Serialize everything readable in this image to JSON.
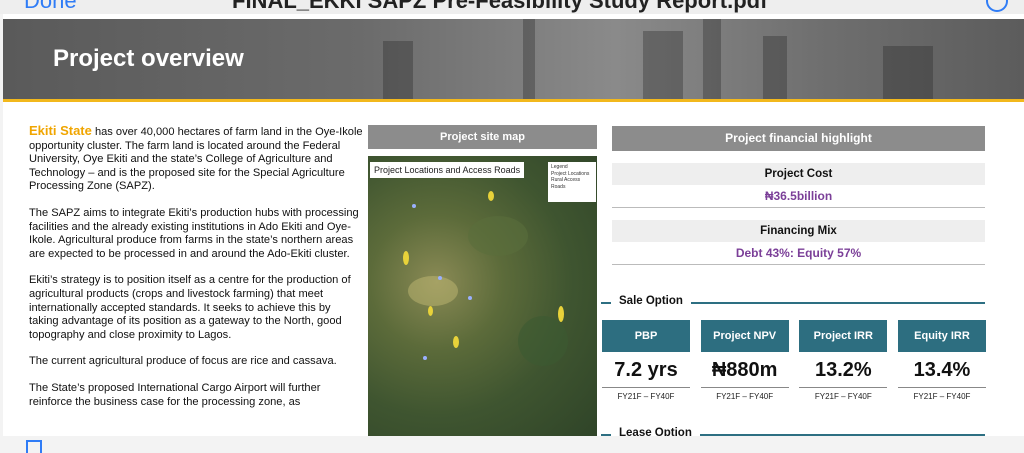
{
  "toolbar": {
    "done_label": "Done",
    "filename": "FINAL_EKKI SAPZ Pre-Feasibility Study Report.pdf",
    "compass_icon": "compass-icon",
    "share_icon": "share-icon"
  },
  "banner": {
    "title": "Project overview"
  },
  "left_text": {
    "state_name": "Ekiti State",
    "p1_rest": " has over 40,000 hectares of farm land in the Oye-Ikole opportunity cluster. The farm land is located around the Federal University, Oye Ekiti and the state’s College of Agriculture and Technology – and is the proposed site for the Special Agriculture Processing Zone (SAPZ).",
    "p2": "The SAPZ aims to integrate Ekiti’s production hubs with processing facilities and the already existing institutions in Ado Ekiti and Oye-Ikole. Agricultural produce from farms in the state’s northern areas are expected to be processed in and around the Ado-Ekiti cluster.",
    "p3": "Ekiti’s strategy is to position itself as a centre for the production of agricultural products (crops and livestock farming) that meet internationally accepted standards. It seeks to achieve this by taking advantage of its position as a gateway to the North, good topography and close proximity to Lagos.",
    "p4": "The current agricultural produce of focus are rice and cassava.",
    "p5": "The State’s proposed International Cargo Airport will further reinforce the business case for the processing zone, as"
  },
  "map": {
    "header": "Project site map",
    "label": "Project Locations and Access Roads",
    "legend_title": "Legend",
    "legend_item1": "Project Locations",
    "legend_item2": "Rural Access Roads"
  },
  "financial": {
    "header": "Project financial highlight",
    "cost_label": "Project Cost",
    "cost_value": "₦36.5billion",
    "mix_label": "Financing Mix",
    "mix_value": "Debt 43%: Equity 57%"
  },
  "sale_option": {
    "label": "Sale Option",
    "tiles": [
      {
        "head": "PBP",
        "value": "7.2 yrs",
        "period": "FY21F – FY40F"
      },
      {
        "head": "Project NPV",
        "value": "₦880m",
        "period": "FY21F – FY40F"
      },
      {
        "head": "Project IRR",
        "value": "13.2%",
        "period": "FY21F – FY40F"
      },
      {
        "head": "Equity IRR",
        "value": "13.4%",
        "period": "FY21F – FY40F"
      }
    ]
  },
  "lease_option": {
    "label": "Lease Option"
  },
  "colors": {
    "accent_gold": "#f2b81c",
    "teal": "#2d6e80",
    "purple": "#7b3f98",
    "ios_blue": "#2f7cf6"
  }
}
